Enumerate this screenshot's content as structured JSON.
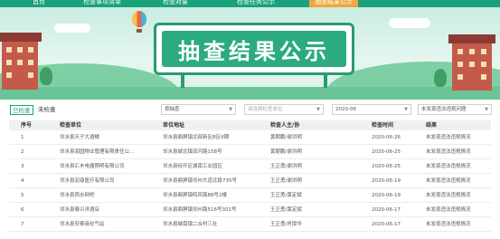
{
  "nav": {
    "items": [
      {
        "label": "首页"
      },
      {
        "label": "检查事项清单"
      },
      {
        "label": "检查对象"
      },
      {
        "label": "检查任务公示"
      },
      {
        "label": "抽查结果公示"
      }
    ]
  },
  "banner": {
    "title": "抽查结果公示"
  },
  "filter": {
    "tab_checked": "已检查",
    "tab_unchecked": "未检查",
    "select_type": "按抽查",
    "select_unit_placeholder": "请选择检查单位",
    "select_date": "2020-06",
    "select_result": "未发现违法违规问题"
  },
  "table": {
    "headers": [
      "序号",
      "检查单位",
      "单位地址",
      "检查人主/协",
      "检查时间",
      "结果"
    ],
    "rows": [
      {
        "no": "1",
        "unit": "邻水县天子大酒楼",
        "address": "邻水县鼎屏镇北部新区B区6期",
        "inspectors": "黄朝鹏/谢洪明",
        "date": "2020-06-26",
        "result": "未发现违法违规情况"
      },
      {
        "no": "2",
        "unit": "邻水县润园物业管理有限责任公...",
        "address": "邻水县城北镇双河路158号",
        "inspectors": "黄朝鹏/谢洪明",
        "date": "2020-06-25",
        "result": "未发现违法违规情况"
      },
      {
        "no": "3",
        "unit": "邻水县汇丰电器照明有限公司",
        "address": "邻水县经开区城南工业园区",
        "inspectors": "王正勇/谢洪明",
        "date": "2020-06-25",
        "result": "未发现违法违规情况"
      },
      {
        "no": "4",
        "unit": "邻水县宏康医疗有限公司",
        "address": "邻水县鼎屏镇邻州大道北段735号",
        "inspectors": "王正勇/谢洪明",
        "date": "2020-06-19",
        "result": "未发现违法违规情况"
      },
      {
        "no": "5",
        "unit": "邻水县西水网吧",
        "address": "邻水县鼎屏镇鸣凤路88号2楼",
        "inspectors": "王正勇/黄定斌",
        "date": "2020-06-19",
        "result": "未发现违法违规情况"
      },
      {
        "no": "6",
        "unit": "邻水县泰兴洋酒店",
        "address": "邻水县鼎屏镇邻州路516号301号",
        "inspectors": "王正勇/黄定斌",
        "date": "2020-06-17",
        "result": "未发现违法违规情况"
      },
      {
        "no": "7",
        "unit": "邻水县安泰液化气站",
        "address": "邻水县城南镇二合村三社",
        "inspectors": "王正勇/肖厚华",
        "date": "2020-06-17",
        "result": "未发现违法违规情况"
      }
    ]
  },
  "colors": {
    "nav_bg": "#1aa27a",
    "nav_active": "#f0a63a",
    "board_green": "#2cab7f"
  }
}
